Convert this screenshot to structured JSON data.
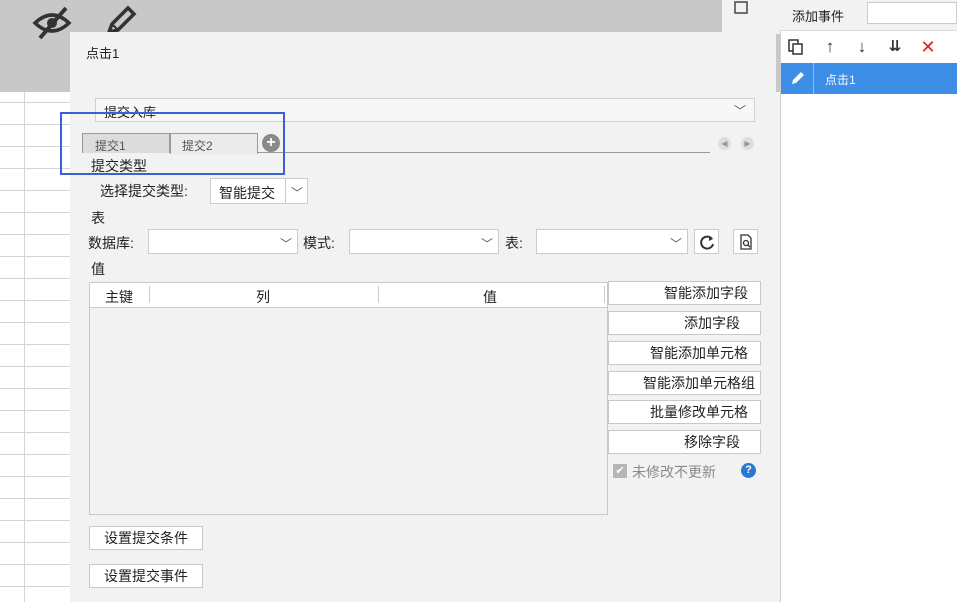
{
  "icons": {
    "eye_off": "eye-off-icon",
    "pencil": "pencil-icon",
    "copy": "copy-icon",
    "up": "arrow-up-icon",
    "down": "arrow-down-icon",
    "bottom": "move-to-bottom-icon",
    "delete": "delete-icon",
    "edit": "edit-icon",
    "refresh": "refresh-icon",
    "preview": "preview-icon",
    "help": "help-icon"
  },
  "colors": {
    "accent": "#3c8ee6",
    "highlight": "#3b5fd6",
    "delete": "#e02020",
    "help": "#2878d0"
  },
  "right_panel": {
    "title": "添加事件",
    "input_value": "",
    "events": [
      {
        "label": "点击1",
        "selected": true
      }
    ]
  },
  "dialog": {
    "title": "点击1",
    "submit_type_select": "提交入库",
    "tabs": [
      {
        "label": "提交1",
        "active": false
      },
      {
        "label": "提交2",
        "active": true
      }
    ],
    "section_submit_type": "提交类型",
    "choose_submit_type_label": "选择提交类型:",
    "choose_submit_type_value": "智能提交",
    "section_table": "表",
    "database_label": "数据库:",
    "database_value": "",
    "schema_label": "模式:",
    "schema_value": "",
    "table_label": "表:",
    "table_value": "",
    "section_value": "值",
    "grid_columns": [
      "主键",
      "列",
      "值"
    ],
    "side_buttons": [
      "智能添加字段",
      "添加字段",
      "智能添加单元格",
      "智能添加单元格组",
      "批量修改单元格",
      "移除字段"
    ],
    "no_update_label": "未修改不更新",
    "no_update_checked": true,
    "bottom_buttons": [
      "设置提交条件",
      "设置提交事件"
    ]
  }
}
